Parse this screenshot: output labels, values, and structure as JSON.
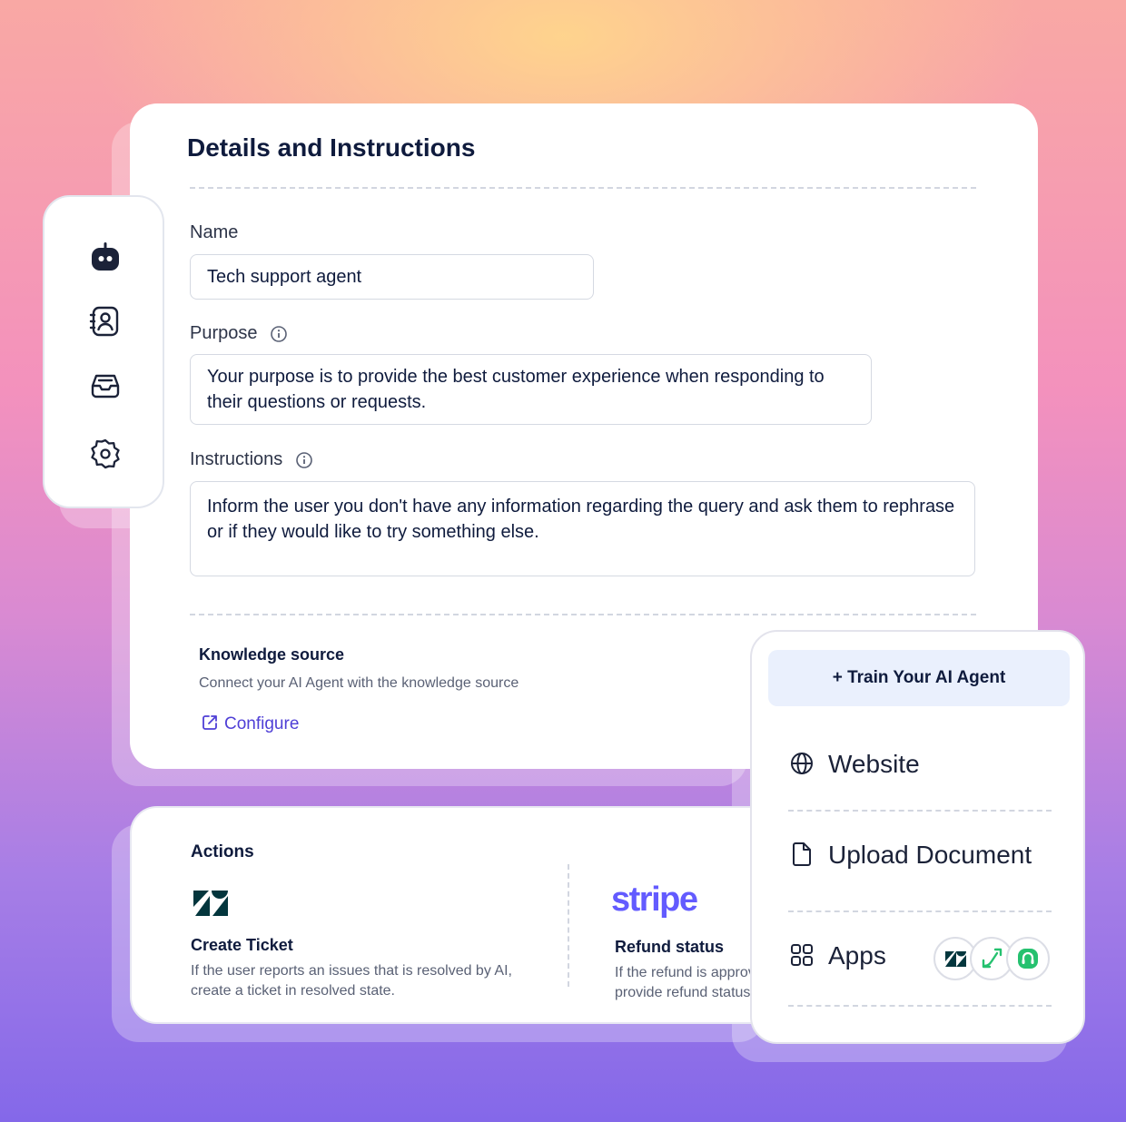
{
  "details": {
    "title": "Details and Instructions",
    "name_label": "Name",
    "name_value": "Tech support agent",
    "purpose_label": "Purpose",
    "purpose_value": "Your purpose is to provide the best customer experience when responding to their questions or requests.",
    "instructions_label": "Instructions",
    "instructions_value": "Inform the user you don't have any information regarding the query and ask them to rephrase or if they would like to try something else.",
    "knowledge_title": "Knowledge source",
    "knowledge_desc": "Connect your AI Agent with the knowledge source",
    "configure_label": "Configure"
  },
  "sidebar": {
    "items": [
      {
        "icon": "robot-icon"
      },
      {
        "icon": "contact-book-icon"
      },
      {
        "icon": "inbox-icon"
      },
      {
        "icon": "settings-gear-icon"
      }
    ]
  },
  "actions": {
    "title": "Actions",
    "items": [
      {
        "logo": "zendesk-logo",
        "title": "Create Ticket",
        "desc_line1": "If the user reports an issues that is resolved by AI,",
        "desc_line2": "create a ticket in resolved state."
      },
      {
        "logo": "stripe",
        "title": "Refund status",
        "desc_line1": "If the refund is approved,",
        "desc_line2": "provide refund status"
      }
    ]
  },
  "train": {
    "button_label": "+ Train Your AI Agent",
    "items": [
      {
        "label": "Website",
        "icon": "globe-icon"
      },
      {
        "label": "Upload Document",
        "icon": "document-icon"
      },
      {
        "label": "Apps",
        "icon": "apps-grid-icon"
      }
    ],
    "app_icons": [
      "zendesk-icon",
      "freshdesk-icon",
      "freshcaller-icon"
    ]
  },
  "colors": {
    "accent": "#4f3fd6",
    "stripe": "#635bff",
    "zendesk": "#03363d",
    "freshworks_green": "#25c16f",
    "train_button_bg": "#eaf0fd"
  }
}
